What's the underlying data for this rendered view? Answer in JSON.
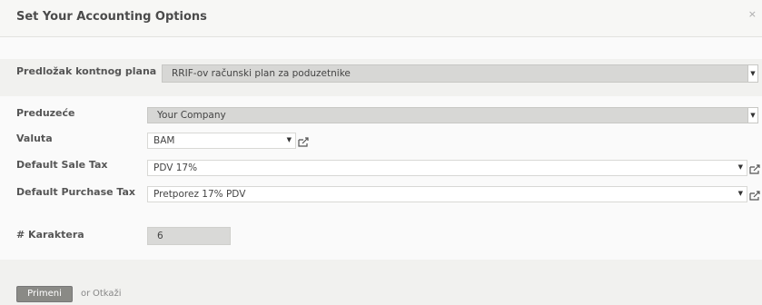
{
  "dialog": {
    "title": "Set Your Accounting Options",
    "close_glyph": "×"
  },
  "form": {
    "chart_template": {
      "label": "Predložak kontnog plana",
      "value": "RRIF-ov računski plan za poduzetnike"
    },
    "company": {
      "label": "Preduzeće",
      "value": "Your Company"
    },
    "currency": {
      "label": "Valuta",
      "value": "BAM"
    },
    "sale_tax": {
      "label": "Default Sale Tax",
      "value": "PDV 17%"
    },
    "purchase_tax": {
      "label": "Default Purchase Tax",
      "value": "Pretporez 17% PDV"
    },
    "digits": {
      "label": "# Karaktera",
      "value": "6"
    }
  },
  "footer": {
    "apply_label": "Primeni",
    "or_text": "or",
    "cancel_label": "Otkaži"
  },
  "icons": {
    "dropdown": "dropdown-arrow-icon",
    "external": "external-link-icon"
  }
}
